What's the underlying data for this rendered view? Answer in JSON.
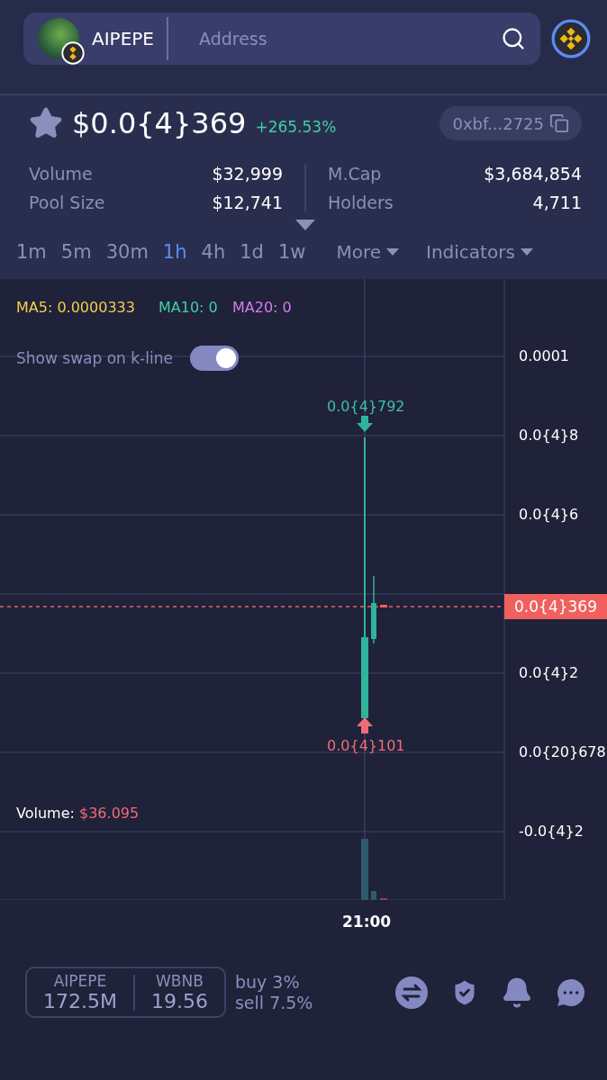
{
  "header": {
    "token": "AIPEPE",
    "search_placeholder": "Address"
  },
  "price": {
    "starred": true,
    "value": "$0.0{4}369",
    "change": "+265.53%",
    "address": "0xbf...2725"
  },
  "stats": [
    {
      "label": "Volume",
      "value": "$32,999"
    },
    {
      "label": "Pool Size",
      "value": "$12,741"
    },
    {
      "label": "M.Cap",
      "value": "$3,684,854"
    },
    {
      "label": "Holders",
      "value": "4,711"
    }
  ],
  "intervals": [
    {
      "label": "1m",
      "selected": false
    },
    {
      "label": "5m",
      "selected": false
    },
    {
      "label": "30m",
      "selected": false
    },
    {
      "label": "1h",
      "selected": true
    },
    {
      "label": "4h",
      "selected": false
    },
    {
      "label": "1d",
      "selected": false
    },
    {
      "label": "1w",
      "selected": false
    }
  ],
  "menus": [
    "More",
    "Indicators"
  ],
  "chart": {
    "ma": [
      {
        "label": "MA5: 0.0000333",
        "color": "#f2cf4a"
      },
      {
        "label": "MA10: 0",
        "color": "#3fd0a6"
      },
      {
        "label": "MA20: 0",
        "color": "#d77cf0"
      }
    ],
    "swap_toggle": {
      "label": "Show swap on k-line",
      "on": true
    },
    "high_label": "0.0{4}792",
    "low_label": "0.0{4}101",
    "price_tag": "0.0{4}369",
    "y_labels": [
      "0.0001",
      "0.0{4}8",
      "0.0{4}6",
      "0.0{4}2",
      "0.0{20}678",
      "-0.0{4}2"
    ],
    "volume_label": "Volume:",
    "volume_value": "$36.095",
    "time_label": "21:00"
  },
  "footer": {
    "pair": [
      {
        "symbol": "AIPEPE",
        "amount": "172.5M"
      },
      {
        "symbol": "WBNB",
        "amount": "19.56"
      }
    ],
    "taxes": [
      "buy 3%",
      "sell 7.5%"
    ]
  }
}
